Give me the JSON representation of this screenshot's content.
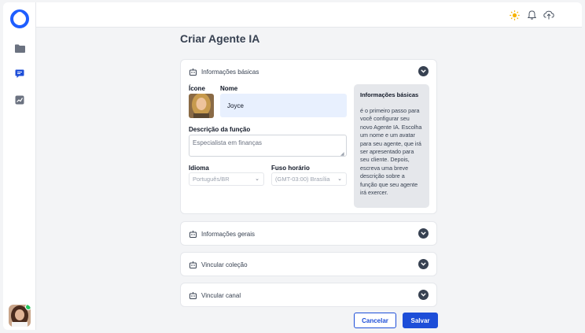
{
  "page": {
    "title": "Criar Agente IA"
  },
  "sections": {
    "basic": {
      "label": "Informações básicas"
    },
    "general": {
      "label": "Informações gerais"
    },
    "collection": {
      "label": "Vincular coleção"
    },
    "channel": {
      "label": "Vincular canal"
    }
  },
  "form": {
    "icon_label": "Ícone",
    "name_label": "Nome",
    "name_value": "Joyce",
    "description_label": "Descrição da função",
    "description_value": "Especialista em finanças",
    "language_label": "Idioma",
    "language_value": "Português/BR",
    "timezone_label": "Fuso horário",
    "timezone_value": "(GMT-03:00) Brasília"
  },
  "help": {
    "title": "Informações básicas",
    "body": "é o primeiro passo para você configurar seu novo Agente IA. Escolha um nome e um avatar para seu agente, que irá ser apresentado para seu cliente. Depois, escreva uma breve descrição sobre a função que seu agente irá exercer."
  },
  "actions": {
    "cancel_label": "Cancelar",
    "save_label": "Salvar"
  },
  "icons": {
    "logo": "ring-logo",
    "nav": [
      "folder-icon",
      "chat-icon",
      "chart-icon"
    ],
    "top": [
      "sun-icon",
      "bell-icon",
      "cloud-upload-icon"
    ]
  },
  "colors": {
    "accent": "#1d4ed8",
    "logo": "#1e5eff",
    "sun": "#f5b301",
    "online": "#22c55e"
  }
}
